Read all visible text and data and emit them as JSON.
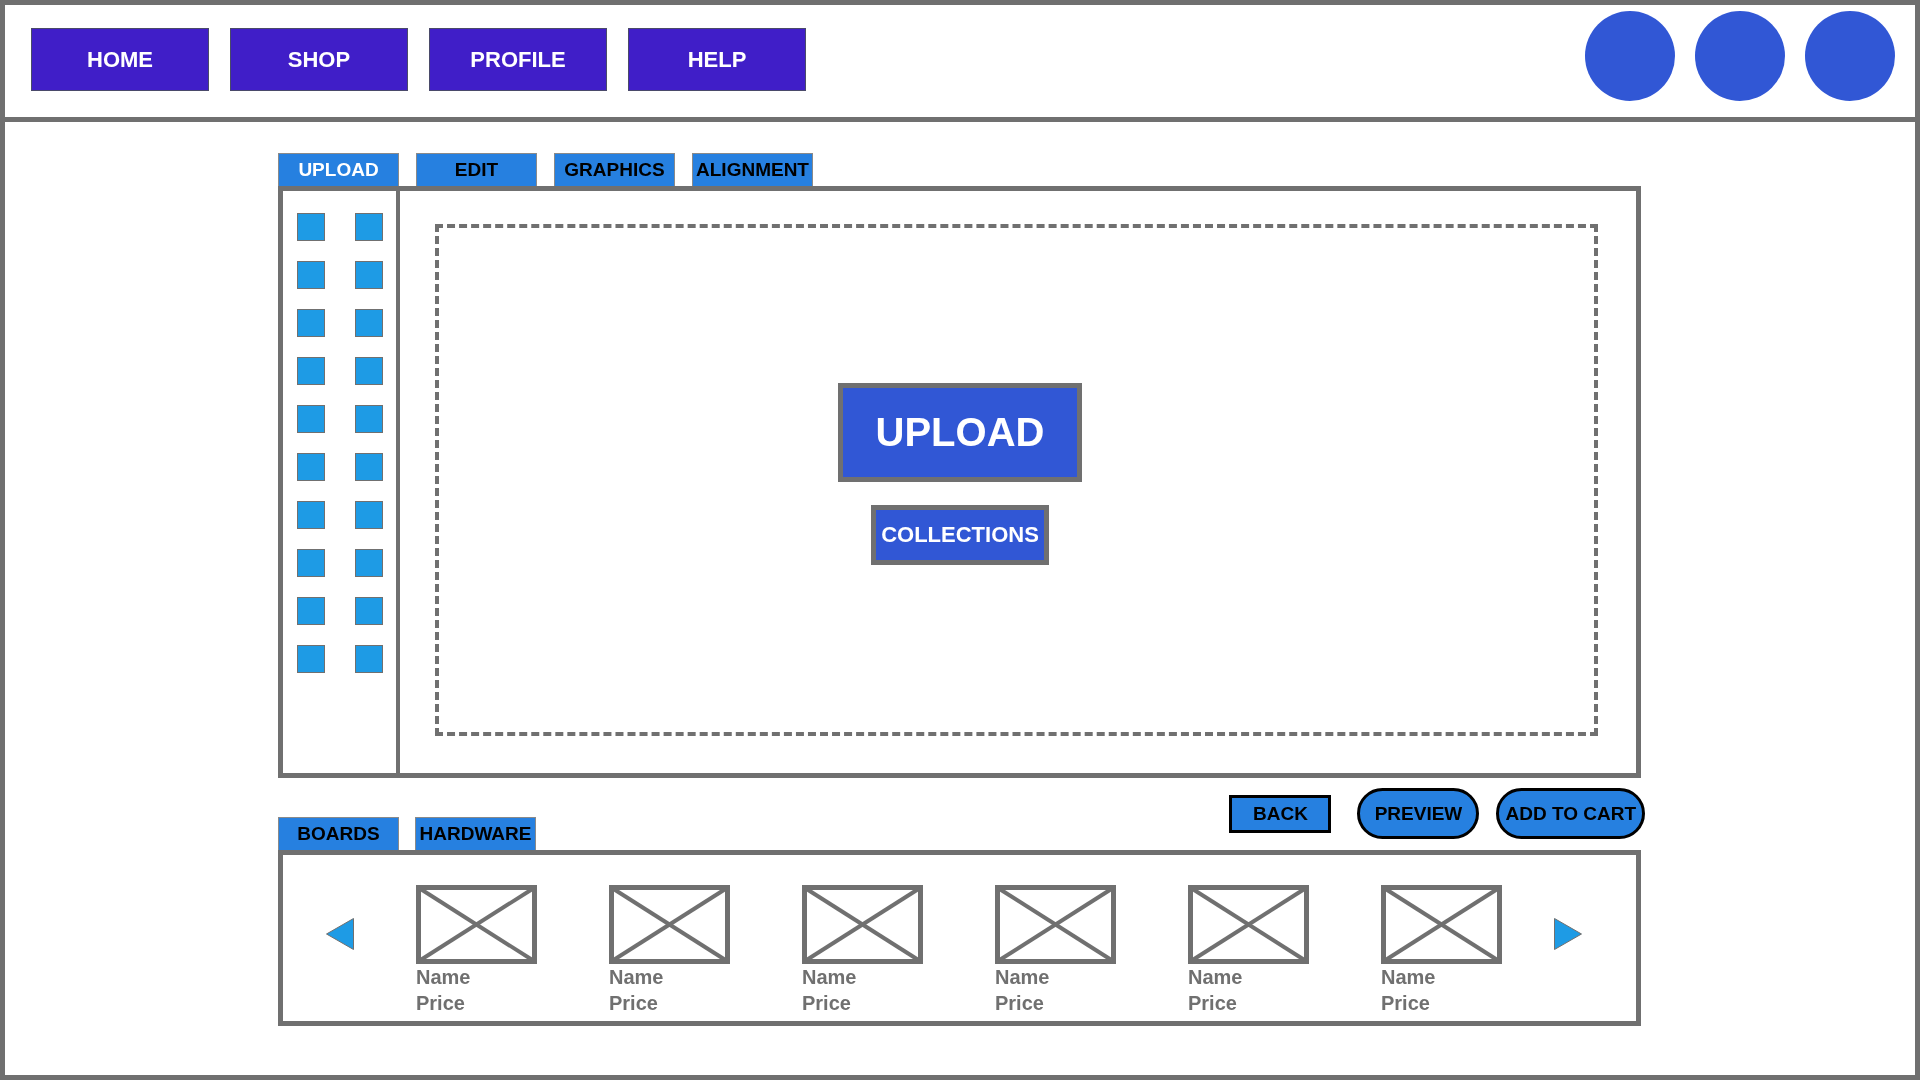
{
  "nav": {
    "buttons": [
      "HOME",
      "SHOP",
      "PROFILE",
      "HELP"
    ]
  },
  "editor_tabs": [
    {
      "label": "UPLOAD",
      "selected": true
    },
    {
      "label": "EDIT",
      "selected": false
    },
    {
      "label": "GRAPHICS",
      "selected": false
    },
    {
      "label": "ALIGNMENT",
      "selected": false
    }
  ],
  "drop_zone": {
    "upload_button": "UPLOAD",
    "collections_button": "COLLECTIONS"
  },
  "actions": [
    {
      "label": "BACK",
      "kind": "box"
    },
    {
      "label": "PREVIEW",
      "kind": "pill"
    },
    {
      "label": "ADD TO CART",
      "kind": "pill"
    }
  ],
  "catalog_tabs": [
    {
      "label": "BOARDS",
      "selected": false
    },
    {
      "label": "HARDWARE",
      "selected": false
    }
  ],
  "products": [
    {
      "name": "Name",
      "price": "Price"
    },
    {
      "name": "Name",
      "price": "Price"
    },
    {
      "name": "Name",
      "price": "Price"
    },
    {
      "name": "Name",
      "price": "Price"
    },
    {
      "name": "Name",
      "price": "Price"
    },
    {
      "name": "Name",
      "price": "Price"
    }
  ]
}
